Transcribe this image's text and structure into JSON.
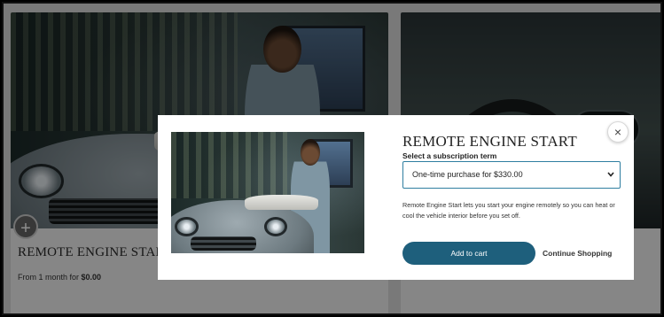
{
  "card_left": {
    "title": "REMOTE ENGINE START",
    "price_prefix": "From 1 month for ",
    "price_value": "$0.00",
    "add_symbol": "+"
  },
  "modal": {
    "title": "REMOTE ENGINE START",
    "select_label": "Select a subscription term",
    "select_value": "One-time purchase for $330.00",
    "description": "Remote Engine Start lets you start your engine remotely so you can heat or cool the vehicle interior before you set off.",
    "add_to_cart": "Add to cart",
    "continue_shopping": "Continue Shopping",
    "close_symbol": "×"
  },
  "icons": {
    "close": "close-icon",
    "chevron": "chevron-down-icon",
    "plus": "plus-icon"
  },
  "colors": {
    "primary_button": "#1e5f7c",
    "select_border": "#2f7ea0"
  }
}
